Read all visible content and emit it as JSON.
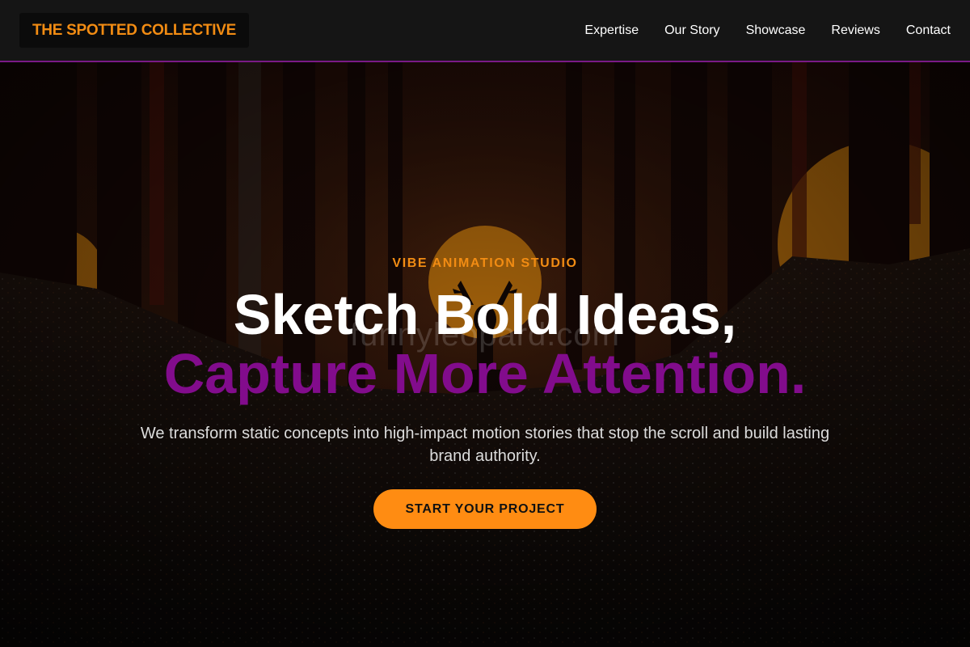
{
  "colors": {
    "accent_orange": "#f28c13",
    "accent_purple": "#820c8c",
    "header_bg": "#151515",
    "cta_bg": "#ff8c12"
  },
  "header": {
    "brand": "THE SPOTTED COLLECTIVE",
    "nav": [
      "Expertise",
      "Our Story",
      "Showcase",
      "Reviews",
      "Contact"
    ]
  },
  "hero": {
    "background_image": "dark forest with stag silhouette and orange sun",
    "eyebrow": "VIBE ANIMATION STUDIO",
    "headline_line1": "Sketch Bold Ideas,",
    "headline_line2": "Capture More Attention.",
    "subtitle": "We transform static concepts into high-impact motion stories that stop the scroll and build lasting brand authority.",
    "cta_label": "START YOUR PROJECT",
    "watermark": "funnyleopard.com"
  }
}
